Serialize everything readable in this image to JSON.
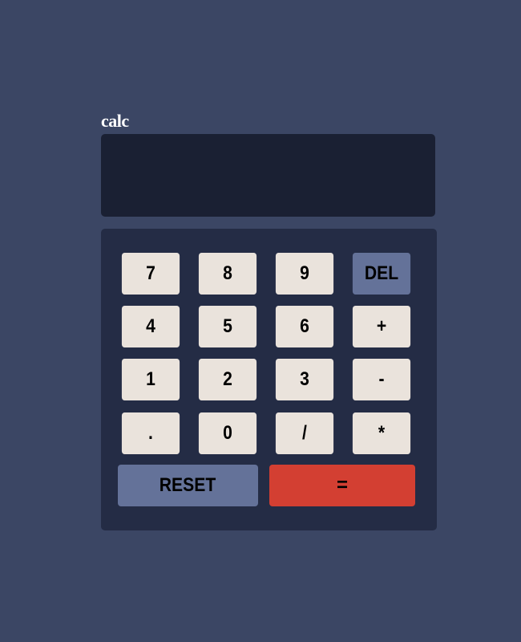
{
  "app": {
    "title": "calc"
  },
  "display": {
    "value": ""
  },
  "keys": {
    "row1": [
      "7",
      "8",
      "9",
      "DEL"
    ],
    "row2": [
      "4",
      "5",
      "6",
      "+"
    ],
    "row3": [
      "1",
      "2",
      "3",
      "-"
    ],
    "row4": [
      ".",
      "0",
      "/",
      "*"
    ],
    "reset": "RESET",
    "equals": "="
  },
  "colors": {
    "background": "#3b4664",
    "display": "#1a2033",
    "keypad": "#242c45",
    "key": "#eae3dc",
    "key_accent": "#647299",
    "equals": "#d33f32"
  }
}
